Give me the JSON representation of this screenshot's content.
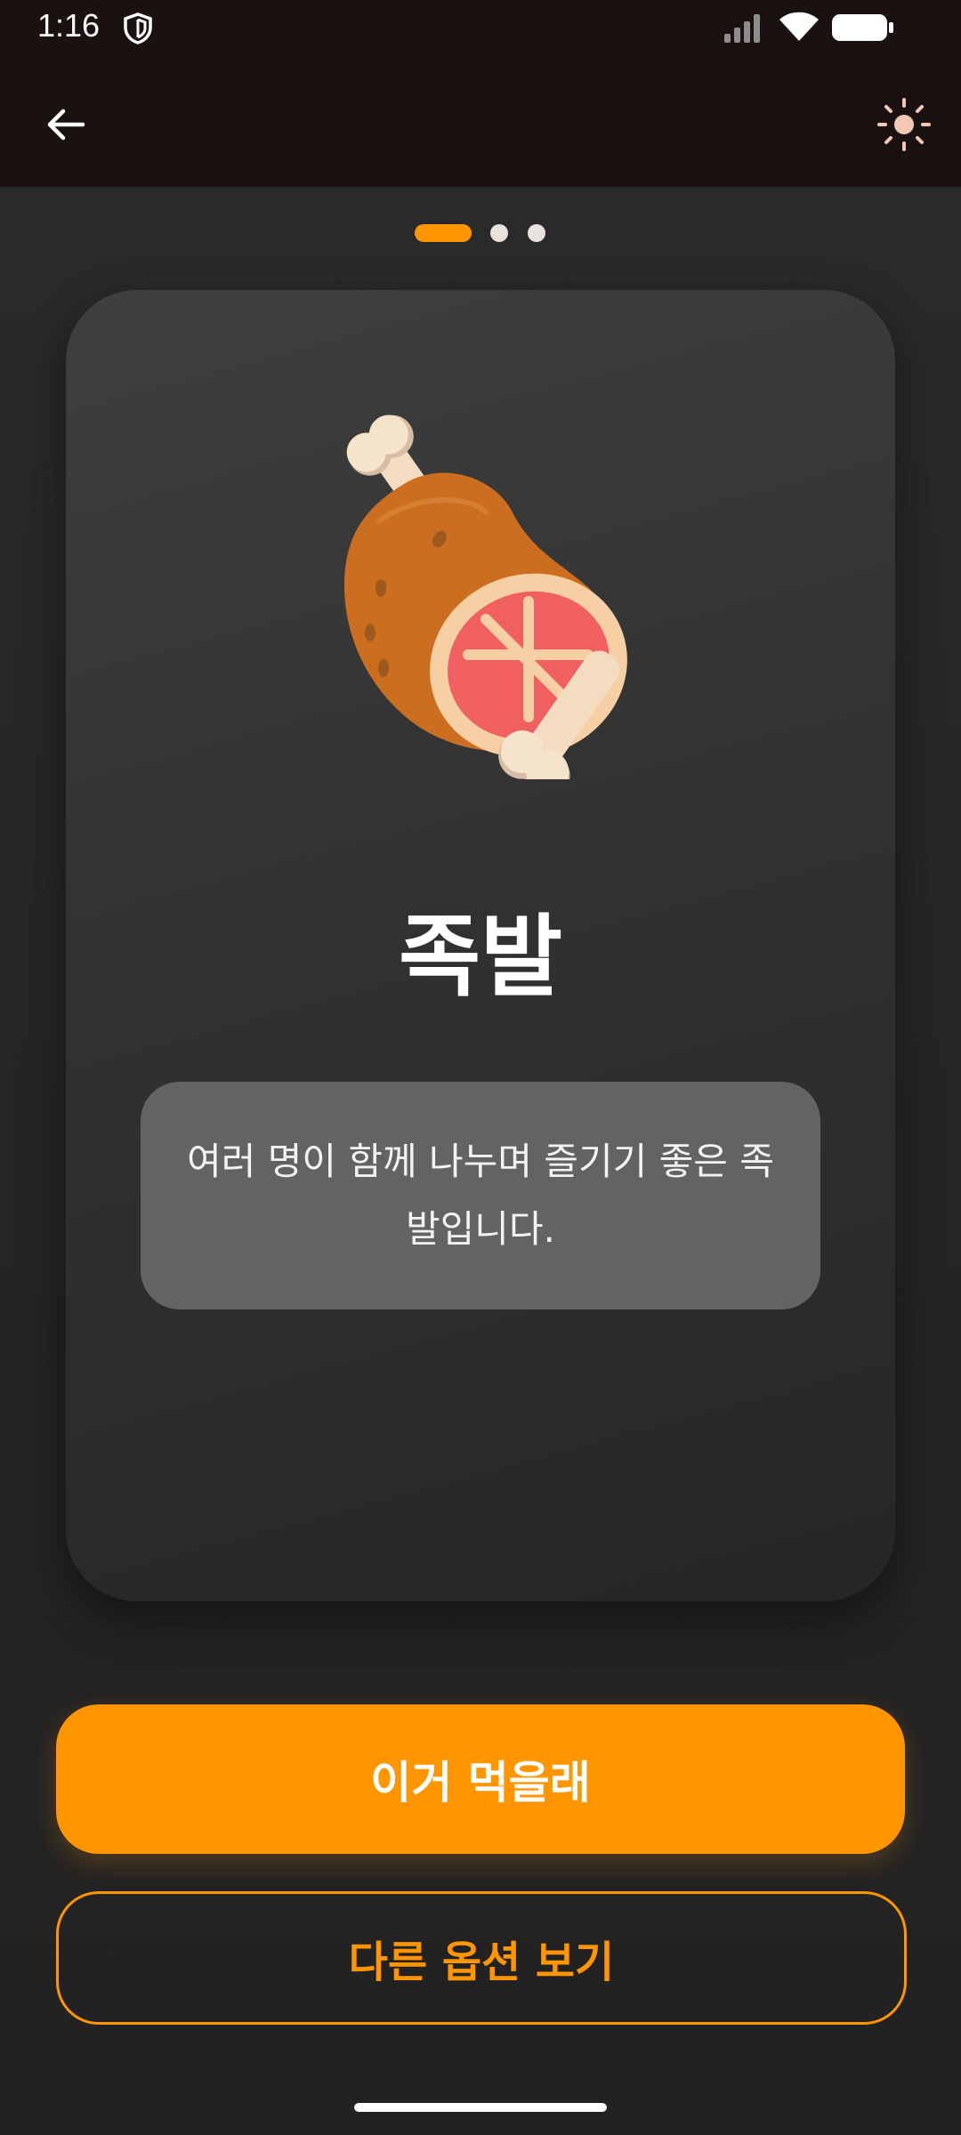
{
  "status_bar": {
    "time": "1:16"
  },
  "app_bar": {
    "back_icon": "arrow-left-icon",
    "theme_icon": "sun-icon"
  },
  "pager": {
    "page_count": 3,
    "active_index": 0
  },
  "card": {
    "illustration": "meat-on-bone-icon",
    "title": "족발",
    "description": "여러 명이 함께 나누며 즐기기 좋은 족발입니다."
  },
  "actions": {
    "primary_label": "이거 먹을래",
    "secondary_label": "다른 옵션 보기"
  },
  "colors": {
    "accent": "#ff9500",
    "app_bar_bg": "#1a1210",
    "card_bg": "#333333",
    "description_bg": "#636363"
  }
}
